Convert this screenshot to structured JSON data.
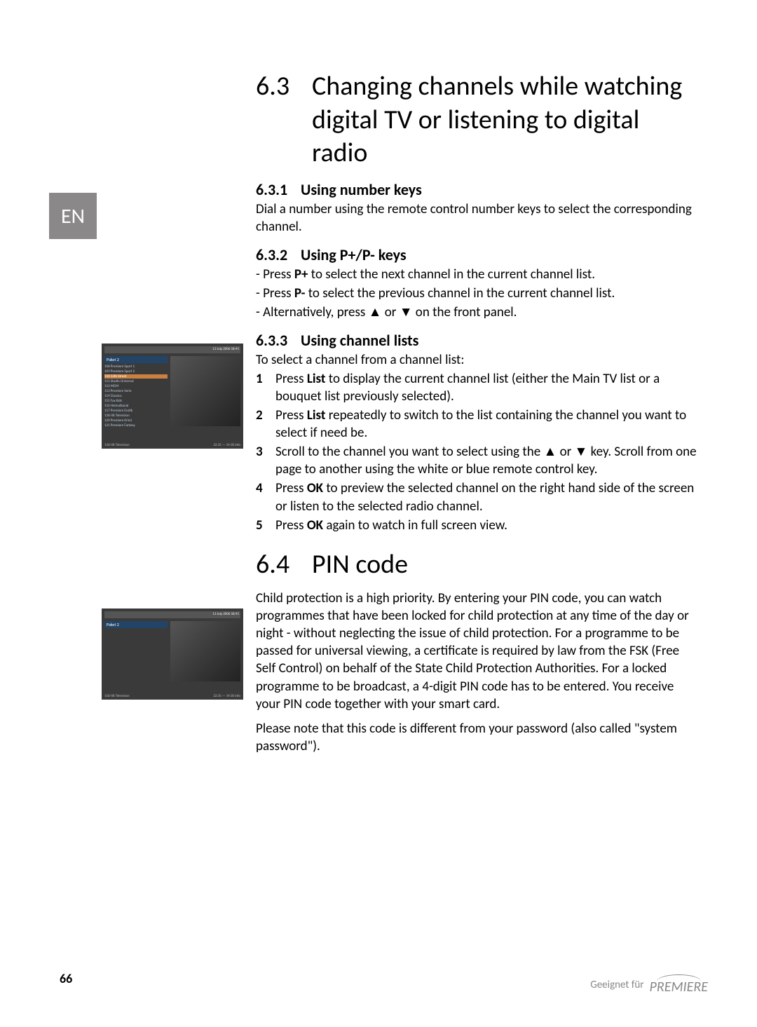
{
  "lang_tab": "EN",
  "section63": {
    "num": "6.3",
    "title": "Changing channels while watching digital TV or listening to digital radio",
    "sub1": {
      "num": "6.3.1",
      "title": "Using number keys",
      "body": "Dial a number using the remote control number keys to select the corresponding channel."
    },
    "sub2": {
      "num": "6.3.2",
      "title": "Using P+/P- keys",
      "b1_pre": "- Press ",
      "b1_key": "P+",
      "b1_post": " to select the next channel in the current channel list.",
      "b2_pre": "- Press ",
      "b2_key": "P-",
      "b2_post": " to select the previous channel in the current channel list.",
      "b3": "- Alternatively, press ▲ or ▼ on the front panel."
    },
    "sub3": {
      "num": "6.3.3",
      "title": "Using channel lists",
      "intro": "To select a channel from a channel list:",
      "s1_pre": "Press ",
      "s1_key": "List",
      "s1_post": " to display the current channel list (either the Main TV list or a bouquet list previously selected).",
      "s2_pre": "Press ",
      "s2_key": "List",
      "s2_post": " repeatedly to switch to the list containing the channel you want to select if need be.",
      "s3": "Scroll to the channel you want to select using the ▲ or ▼ key. Scroll from one page to another using the white or blue remote control key.",
      "s4_pre": "Press ",
      "s4_key": "OK",
      "s4_post": " to preview the selected channel on the right hand side of the screen or listen to the selected radio channel.",
      "s5_pre": "Press ",
      "s5_key": "OK",
      "s5_post": " again to watch in full screen view."
    }
  },
  "section64": {
    "num": "6.4",
    "title": "PIN code",
    "p1": "Child protection is a high priority. By entering your PIN code, you can watch programmes that have been locked for child protection at any time of the day or night - without neglecting the issue of child protection. For a programme to be passed for universal viewing, a certificate is required by law from the FSK (Free Self Control) on behalf of the State Child Protection Authorities. For a locked programme to be broadcast, a 4-digit PIN code has to be entered. You receive your PIN code together with your smart card.",
    "p2": "Please note that this code is different from your password (also called \"system password\")."
  },
  "screenshot": {
    "datetime": "13 July 2006   18:45",
    "list_header": "Paket 2",
    "channels": [
      "108  Premiere Sport 1",
      "109  Premiere Sport 2",
      "110  13th Street",
      "111  Studio Universal",
      "112  MGM",
      "113  Premiere Serie",
      "114  Classica",
      "115  Fox Kids",
      "116  Heimatkanal",
      "117  Premiere Erotik",
      "118  Hit Television",
      "120  Premiere Krimi",
      "121  Premiere Fantasy"
    ],
    "selected": "110  13th Street",
    "footer_left": "118  Hit Television",
    "footer_right": "22:35 — 14:30  info"
  },
  "page_number": "66",
  "footer_label": "Geeignet für",
  "footer_brand": "PREMIERE"
}
